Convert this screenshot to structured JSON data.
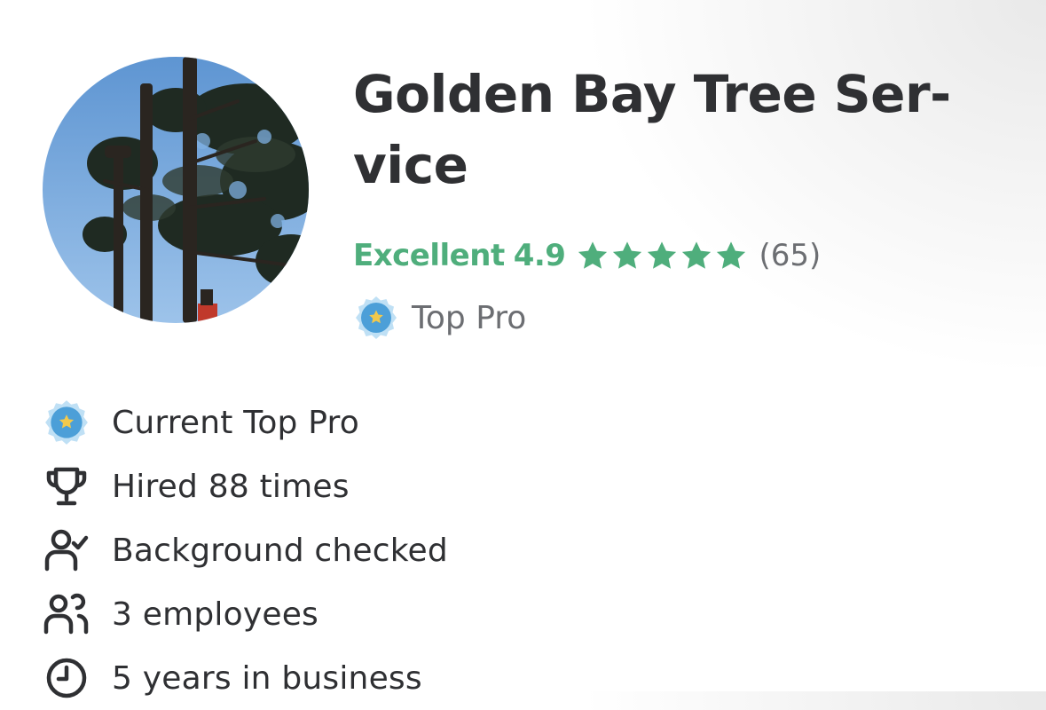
{
  "profile": {
    "business_name": "Golden Bay Tree Ser-vice",
    "rating": {
      "label": "Excellent",
      "score": "4.9",
      "stars": 5,
      "review_count": "(65)",
      "color": "#4fae7c"
    },
    "badge": {
      "label": "Top Pro",
      "icon": "top-pro-badge-icon"
    }
  },
  "facts": [
    {
      "icon": "top-pro-badge-icon",
      "text": "Current Top Pro"
    },
    {
      "icon": "trophy-icon",
      "text": "Hired 88 times"
    },
    {
      "icon": "background-check-icon",
      "text": "Background checked"
    },
    {
      "icon": "employees-icon",
      "text": "3 employees"
    },
    {
      "icon": "clock-icon",
      "text": "5 years in business"
    }
  ],
  "colors": {
    "text_primary": "#2f3033",
    "text_secondary": "#6c6e72",
    "badge_blue": "#4c9fd8",
    "badge_star": "#f2c94c"
  }
}
